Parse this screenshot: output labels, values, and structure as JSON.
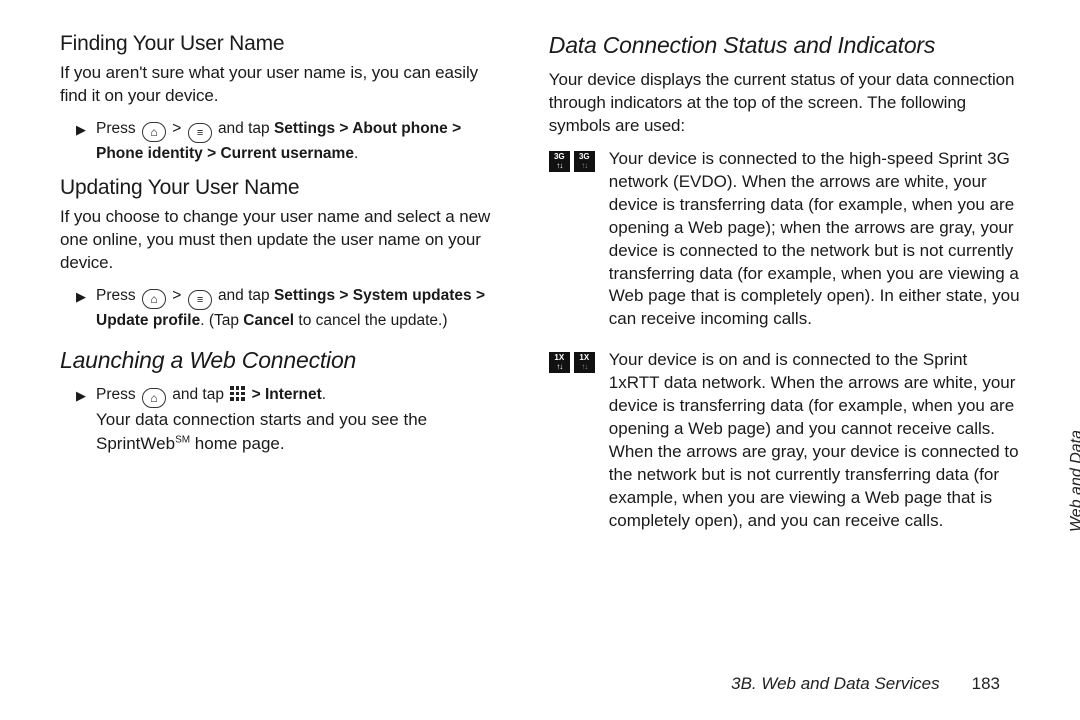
{
  "left": {
    "sec1": {
      "heading": "Finding Your User Name",
      "body": "If you aren't sure what your user name is, you can easily find it on your device.",
      "step_prefix": "Press ",
      "step_mid": " and tap ",
      "step_bold": "Settings > About phone > Phone identity > Current username",
      "step_suffix": "."
    },
    "sec2": {
      "heading": "Updating Your User Name",
      "body": "If you choose to change your user name and select a new one online, you must then update the user name on your device.",
      "step_prefix": "Press ",
      "step_mid": " and tap ",
      "step_bold1": "Settings > System updates > Update profile",
      "step_mid2": ". (Tap ",
      "step_bold2": "Cancel",
      "step_suffix": " to cancel the update.)"
    },
    "sec3": {
      "heading": "Launching a Web Connection",
      "step_prefix": "Press ",
      "step_mid": " and tap ",
      "step_bold": " > Internet",
      "step_suffix": ".",
      "line2a": "Your data connection starts and you see the SprintWeb",
      "line2b": " home page."
    }
  },
  "right": {
    "heading": "Data Connection Status and Indicators",
    "intro": "Your device displays the current status of your data connection through indicators at the top of the screen. The following symbols are used:",
    "items": [
      {
        "badge": "3G",
        "text": "Your device is connected to the high-speed Sprint 3G network (EVDO). When the arrows are white, your device is transferring data (for example, when you are opening a Web page); when the arrows are gray, your device is connected to the network but is not currently transferring data (for example, when you are viewing a Web page that is completely open). In either state, you can receive incoming calls."
      },
      {
        "badge": "1X",
        "text": "Your device is on and is connected to the Sprint 1xRTT data network. When the arrows are white, your device is transferring data (for example, when you are opening a Web page) and you cannot receive calls. When the arrows are gray, your device is connected to the network but is not currently transferring data (for example, when you are viewing a Web page that is completely open), and you can receive calls."
      }
    ]
  },
  "sideTab": "Web and Data",
  "footer": {
    "section": "3B. Web and Data Services",
    "page": "183"
  },
  "glyphs": {
    "triangle": "▶",
    "gt": ">"
  }
}
